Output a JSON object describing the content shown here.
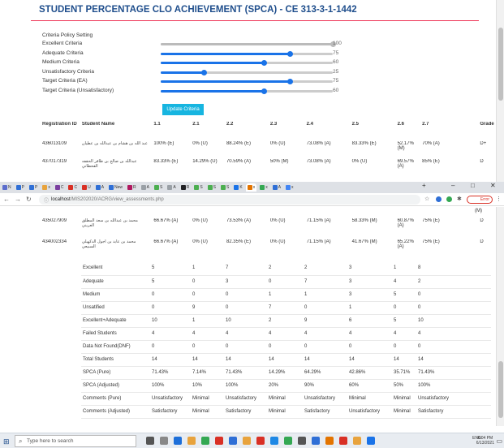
{
  "page": {
    "title": "STUDENT PERCENTAGE CLO ACHIEVEMENT (SPCA) - CE 313-3-1-1442",
    "criteria_heading": "Criteria Policy Setting",
    "update_button": "Update Criteria"
  },
  "criteria": [
    {
      "label": "Excellent Criteria",
      "value": "100",
      "level": 100,
      "color": "#bbbbbb"
    },
    {
      "label": "Adequate Criteria",
      "value": "75",
      "level": 75,
      "color": "#1a73e8"
    },
    {
      "label": "Medium Criteria",
      "value": "60",
      "level": 60,
      "color": "#1a73e8"
    },
    {
      "label": "Unsatisfactory Criteria",
      "value": "25",
      "level": 25,
      "color": "#1a73e8"
    },
    {
      "label": "Target Criteria (EA)",
      "value": "75",
      "level": 75,
      "color": "#1a73e8"
    },
    {
      "label": "Target Criteria (Unsatisfactory)",
      "value": "60",
      "level": 60,
      "color": "#1a73e8"
    }
  ],
  "table": {
    "headers": [
      "Registration ID",
      "Student Name",
      "1.1",
      "2.1",
      "2.2",
      "2.3",
      "2.4",
      "2.5",
      "2.6",
      "2.7",
      "Grade"
    ],
    "rows_top": [
      [
        "436013109",
        "عبد الله بن هشام بن عبدالله بن عطيان",
        "100% (E)",
        "0% (U)",
        "88.24% (E)",
        "0% (U)",
        "73.08% (A)",
        "83.33% (E)",
        "52.17% (M)",
        "70% (A)",
        "D+"
      ],
      [
        "437017319",
        "عبدالله بن صالح بن ظافر الحقفه القحطاني",
        "83.33% (E)",
        "14.29% (U)",
        "70.59% (A)",
        "50% (M)",
        "73.08% (A)",
        "0% (U)",
        "69.57% (A)",
        "85% (E)",
        "D"
      ]
    ],
    "partial_row_top": "(M)",
    "rows_bottom": [
      [
        "435027909",
        "محمد بن عبدالله بن سعد المطلق العريني",
        "66.67% (A)",
        "0% (U)",
        "73.53% (A)",
        "0% (U)",
        "71.15% (A)",
        "58.33% (M)",
        "60.87% (A)",
        "75% (E)",
        "D"
      ],
      [
        "434002334",
        "محمد بن عايد بن آجول الدكهيلي السبيعي",
        "66.67% (A)",
        "0% (U)",
        "82.35% (E)",
        "0% (U)",
        "71.15% (A)",
        "41.67% (M)",
        "65.22% (A)",
        "75% (E)",
        "D"
      ]
    ]
  },
  "stats": [
    [
      "Excellent",
      "5",
      "1",
      "7",
      "2",
      "2",
      "3",
      "1",
      "8"
    ],
    [
      "Adequate",
      "5",
      "0",
      "3",
      "0",
      "7",
      "3",
      "4",
      "2"
    ],
    [
      "Medium",
      "0",
      "0",
      "0",
      "1",
      "1",
      "3",
      "5",
      "0"
    ],
    [
      "Unsatified",
      "0",
      "9",
      "0",
      "7",
      "0",
      "1",
      "0",
      "0"
    ],
    [
      "Excellent+Adequate",
      "10",
      "1",
      "10",
      "2",
      "9",
      "6",
      "5",
      "10"
    ],
    [
      "Failed Students",
      "4",
      "4",
      "4",
      "4",
      "4",
      "4",
      "4",
      "4"
    ],
    [
      "Data Not Found(DNF)",
      "0",
      "0",
      "0",
      "0",
      "0",
      "0",
      "0",
      "0"
    ],
    [
      "Total Students",
      "14",
      "14",
      "14",
      "14",
      "14",
      "14",
      "14",
      "14"
    ],
    [
      "SPCA (Pure)",
      "71.43%",
      "7.14%",
      "71.43%",
      "14.29%",
      "64.29%",
      "42.86%",
      "35.71%",
      "71.43%"
    ],
    [
      "SPCA (Adjusted)",
      "100%",
      "10%",
      "100%",
      "20%",
      "90%",
      "60%",
      "50%",
      "100%"
    ],
    [
      "Comments (Pure)",
      "Unsatisfactory",
      "Minimal",
      "Unsatisfactory",
      "Minimal",
      "Unsatisfactory",
      "Minimal",
      "Minimal",
      "Unsatisfactory"
    ],
    [
      "Comments (Adjusted)",
      "Satisfactory",
      "Minimal",
      "Satisfactory",
      "Minimal",
      "Satisfactory",
      "Unsatisfactory",
      "Minimal",
      "Satisfactory"
    ]
  ],
  "browser": {
    "tabs": [
      {
        "label": "N",
        "color": "#5b6dcd"
      },
      {
        "label": "P",
        "color": "#2f6fd6"
      },
      {
        "label": "P",
        "color": "#2f6fd6"
      },
      {
        "label": "x",
        "color": "#e8a33d"
      },
      {
        "label": "C",
        "color": "#7b3fa0"
      },
      {
        "label": "C",
        "color": "#d93025"
      },
      {
        "label": "U",
        "color": "#d93025"
      },
      {
        "label": "A",
        "color": "#2f6fd6"
      },
      {
        "label": "New",
        "color": "#2f6fd6"
      },
      {
        "label": "R",
        "color": "#b0185f"
      },
      {
        "label": "A",
        "color": "#9aa0a6"
      },
      {
        "label": "S",
        "color": "#4caf50"
      },
      {
        "label": "A",
        "color": "#9aa0a6"
      },
      {
        "label": "R",
        "color": "#202124"
      },
      {
        "label": "S",
        "color": "#4caf50"
      },
      {
        "label": "S",
        "color": "#4caf50"
      },
      {
        "label": "S",
        "color": "#4caf50"
      },
      {
        "label": "K",
        "color": "#1a73e8"
      },
      {
        "label": "x",
        "color": "#e37400",
        "active": true
      },
      {
        "label": "x",
        "color": "#34a853"
      },
      {
        "label": "A",
        "color": "#2f6fd6"
      },
      {
        "label": "x",
        "color": "#4285f4"
      }
    ],
    "url_host": "localhost",
    "url_path": "/MIS202020/ACRG/view_assessments.php",
    "profile_label": "Error"
  },
  "taskbar": {
    "search_placeholder": "Type here to search",
    "time": "6:04 PM",
    "date": "6/13/2021",
    "lang": "ENG"
  }
}
